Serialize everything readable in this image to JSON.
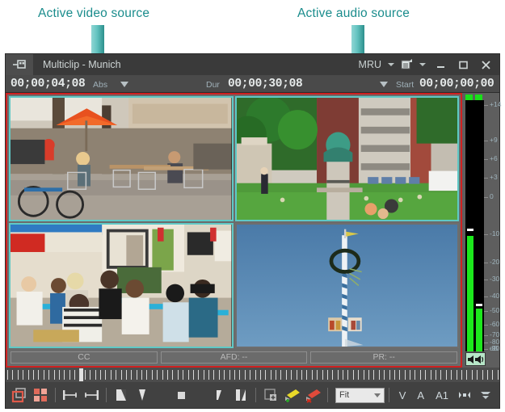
{
  "annotations": [
    {
      "id": "video",
      "text": "Active video source",
      "color": "#1a8c8c"
    },
    {
      "id": "audio",
      "text": "Active audio source",
      "color": "#1a8c8c"
    }
  ],
  "window": {
    "title": "Multiclip - Munich",
    "pin_icon": "pin-window-icon",
    "right_controls": {
      "mru_label": "MRU",
      "mru_caret_icon": "chevron-down-icon",
      "properties_icon": "properties-icon",
      "properties_caret_icon": "chevron-down-icon",
      "minimize_icon": "minimize-icon",
      "maximize_icon": "maximize-icon",
      "close_icon": "close-icon"
    }
  },
  "timecode": {
    "current": "00;00;04;08",
    "abs_label": "Abs",
    "abs_dropdown_icon": "triangle-down-icon",
    "dur_label": "Dur",
    "duration": "00;00;30;08",
    "start_dropdown_icon": "triangle-down-icon",
    "start_label": "Start",
    "start": "00;00;00;00"
  },
  "quad": {
    "active_border_color": "#5fc9c6",
    "record_border_color": "#d02020",
    "cells": [
      {
        "name": "cell-top-left",
        "scene": "outdoor-cafe-orange-umbrella",
        "active": true
      },
      {
        "name": "cell-top-right",
        "scene": "park-statue-bust",
        "active": true
      },
      {
        "name": "cell-bottom-left",
        "scene": "cafe-terrace-crowd",
        "active": true
      },
      {
        "name": "cell-bottom-right",
        "scene": "maypole-blue-sky",
        "active": false
      }
    ]
  },
  "status_bar": {
    "cc": "CC",
    "afd": "AFD: --",
    "pr": "PR: --"
  },
  "audio_meter": {
    "clip_leds": 2,
    "speaker_icon": "speaker-mute-icon",
    "unit_label": "dB",
    "scale": [
      "+14",
      "+9",
      "+6",
      "+3",
      "0",
      "-10",
      "-20",
      "-30",
      "-40",
      "-50",
      "-60",
      "-70",
      "-80",
      "-90"
    ],
    "channels": [
      {
        "name": "channel-left",
        "level_db": -17,
        "peak_db": -15
      },
      {
        "name": "channel-right",
        "level_db": -59,
        "peak_db": -57
      }
    ],
    "fill_color": "#1ce81c"
  },
  "ruler": {
    "playhead_position_pct": 14.8,
    "tick_count": 96
  },
  "toolbar": {
    "items": [
      {
        "name": "single-view-button",
        "icon": "single-frame-icon",
        "interactable": true
      },
      {
        "name": "quad-view-button",
        "icon": "quad-split-icon",
        "interactable": true
      },
      {
        "name": "separator-1",
        "icon": "separator",
        "interactable": false
      },
      {
        "name": "mark-in-button",
        "icon": "mark-in-icon",
        "interactable": true
      },
      {
        "name": "mark-out-button",
        "icon": "mark-out-icon",
        "interactable": true
      },
      {
        "name": "separator-2",
        "icon": "separator",
        "interactable": false
      },
      {
        "name": "goto-in-button",
        "icon": "goto-in-icon",
        "interactable": true
      },
      {
        "name": "goto-out-button",
        "icon": "goto-out-icon",
        "interactable": true
      },
      {
        "name": "stop-button",
        "icon": "stop-square-icon",
        "interactable": true
      },
      {
        "name": "clear-in-button",
        "icon": "clear-in-icon",
        "interactable": true
      },
      {
        "name": "clear-out-button",
        "icon": "clear-out-icon",
        "interactable": true
      },
      {
        "name": "separator-3",
        "icon": "separator",
        "interactable": false
      },
      {
        "name": "add-subclip-button",
        "icon": "add-subclip-icon",
        "interactable": true
      },
      {
        "name": "add-marker-button",
        "icon": "add-marker-yellow-icon",
        "interactable": true
      },
      {
        "name": "delete-marker-button",
        "icon": "delete-marker-red-icon",
        "interactable": true
      },
      {
        "name": "separator-4",
        "icon": "separator",
        "interactable": false
      }
    ],
    "zoom_select": {
      "value": "Fit",
      "caret_icon": "chevron-down-icon"
    },
    "track_buttons": [
      "V",
      "A",
      "A1"
    ],
    "match-frame_icon": "match-frame-icon",
    "more_icon": "more-options-icon"
  }
}
